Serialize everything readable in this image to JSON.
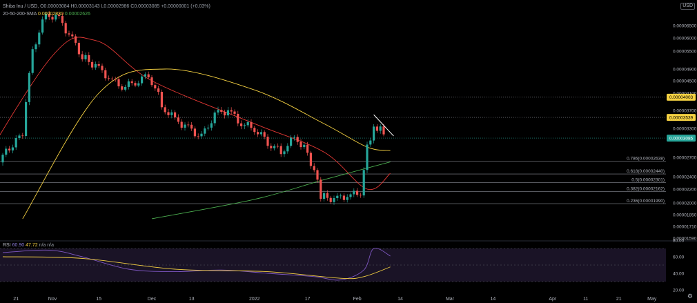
{
  "legend": {
    "title": "Shiba Inu / USD, ",
    "ohlc": "O0.00003084 H0.00003143 L0.00002986 C0.00003085 +0.00000001 (+0.03%)",
    "sma_label": "20-50-200-SMA",
    "sma_values": [
      "0.00002830",
      "0.00002626"
    ],
    "rsi_label": "RSI",
    "rsi_values": [
      "60.90",
      "47.72",
      "n/a",
      "n/a"
    ]
  },
  "currency_badge": "USD",
  "colors": {
    "background": "#000000",
    "up": "#26a69a",
    "down": "#ef5350",
    "sma20": "#e53935",
    "sma50": "#f5d142",
    "sma200": "#4caf50",
    "rsi": "#7e57c2",
    "rsi_ma": "#f5d142",
    "current_price": "#26a69a",
    "highlight_level": "#f5d142",
    "trendline": "#ffffff"
  },
  "chart_data": {
    "type": "line",
    "subtype": "candlestick",
    "x_ticks": [
      "21",
      "Nov",
      "15",
      "Dec",
      "13",
      "2022",
      "17",
      "Feb",
      "14",
      "Mar",
      "14",
      "Apr",
      "11",
      "21",
      "May"
    ],
    "y_ticks": [
      "0.00006500",
      "0.00006000",
      "0.00005500",
      "0.00004900",
      "0.00004500",
      "0.00004100",
      "0.00003700",
      "0.00003300",
      "0.00002700",
      "0.00002400",
      "0.00002200",
      "0.00002000",
      "0.00001850",
      "0.00001710",
      "0.00001590"
    ],
    "ylim": [
      1.59e-05,
      7e-05
    ],
    "grid": false,
    "series": [
      {
        "kind": "candles",
        "points": [
          {
            "date": "2021-10-17",
            "value": 2.7e-05
          },
          {
            "date": "2021-10-20",
            "value": 2.85e-05
          },
          {
            "date": "2021-10-24",
            "value": 3.2e-05
          },
          {
            "date": "2021-10-27",
            "value": 5.5e-05
          },
          {
            "date": "2021-10-31",
            "value": 7e-05
          },
          {
            "date": "2021-11-04",
            "value": 6.8e-05
          },
          {
            "date": "2021-11-08",
            "value": 5.9e-05
          },
          {
            "date": "2021-11-11",
            "value": 5.3e-05
          },
          {
            "date": "2021-11-15",
            "value": 5e-05
          },
          {
            "date": "2021-11-19",
            "value": 4.6e-05
          },
          {
            "date": "2021-11-23",
            "value": 4.3e-05
          },
          {
            "date": "2021-11-27",
            "value": 4.45e-05
          },
          {
            "date": "2021-12-01",
            "value": 4.7e-05
          },
          {
            "date": "2021-12-05",
            "value": 3.8e-05
          },
          {
            "date": "2021-12-09",
            "value": 3.5e-05
          },
          {
            "date": "2021-12-13",
            "value": 3.3e-05
          },
          {
            "date": "2021-12-17",
            "value": 3.1e-05
          },
          {
            "date": "2021-12-21",
            "value": 3.6e-05
          },
          {
            "date": "2021-12-25",
            "value": 3.7e-05
          },
          {
            "date": "2021-12-29",
            "value": 3.4e-05
          },
          {
            "date": "2022-01-02",
            "value": 3.3e-05
          },
          {
            "date": "2022-01-06",
            "value": 3e-05
          },
          {
            "date": "2022-01-10",
            "value": 2.8e-05
          },
          {
            "date": "2022-01-14",
            "value": 3.1e-05
          },
          {
            "date": "2022-01-17",
            "value": 2.9e-05
          },
          {
            "date": "2022-01-20",
            "value": 2.5e-05
          },
          {
            "date": "2022-01-22",
            "value": 2.1e-05
          },
          {
            "date": "2022-01-26",
            "value": 2.05e-05
          },
          {
            "date": "2022-01-30",
            "value": 2.1e-05
          },
          {
            "date": "2022-02-03",
            "value": 2.15e-05
          },
          {
            "date": "2022-02-05",
            "value": 2.9e-05
          },
          {
            "date": "2022-02-07",
            "value": 3.3e-05
          },
          {
            "date": "2022-02-09",
            "value": 3.35e-05
          },
          {
            "date": "2022-02-11",
            "value": 3.085e-05
          }
        ]
      },
      {
        "kind": "sma20",
        "points": [
          {
            "date": "2021-10-01",
            "value": 1.8e-05
          },
          {
            "date": "2021-10-31",
            "value": 5.2e-05
          },
          {
            "date": "2021-11-14",
            "value": 5.9e-05
          },
          {
            "date": "2021-12-01",
            "value": 4.5e-05
          },
          {
            "date": "2022-01-01",
            "value": 3.4e-05
          },
          {
            "date": "2022-01-22",
            "value": 2.8e-05
          },
          {
            "date": "2022-02-04",
            "value": 2.2e-05
          },
          {
            "date": "2022-02-11",
            "value": 2.45e-05
          }
        ]
      },
      {
        "kind": "sma50",
        "points": [
          {
            "date": "2021-10-23",
            "value": 1.8e-05
          },
          {
            "date": "2021-11-15",
            "value": 4.1e-05
          },
          {
            "date": "2021-12-05",
            "value": 4.9e-05
          },
          {
            "date": "2022-01-01",
            "value": 4.2e-05
          },
          {
            "date": "2022-01-22",
            "value": 3.4e-05
          },
          {
            "date": "2022-02-04",
            "value": 2.9e-05
          },
          {
            "date": "2022-02-11",
            "value": 2.83e-05
          }
        ]
      },
      {
        "kind": "sma200",
        "points": [
          {
            "date": "2021-12-01",
            "value": 1.8e-05
          },
          {
            "date": "2022-01-01",
            "value": 2.05e-05
          },
          {
            "date": "2022-01-22",
            "value": 2.35e-05
          },
          {
            "date": "2022-02-11",
            "value": 2.626e-05
          }
        ]
      }
    ],
    "fib_levels": [
      {
        "label": "0.786(0.00002638)",
        "value": 2.638e-05
      },
      {
        "label": "0.618(0.00002440)",
        "value": 2.44e-05
      },
      {
        "label": "0.5(0.00002301)",
        "value": 2.301e-05
      },
      {
        "label": "0.382(0.00002162)",
        "value": 2.162e-05
      },
      {
        "label": "0.236(0.00001990)",
        "value": 1.99e-05
      }
    ],
    "price_labels": [
      {
        "label": "0.00004003",
        "value": 4.003e-05,
        "style": "highlight"
      },
      {
        "label": "0.00003539",
        "value": 3.539e-05,
        "style": "highlight"
      },
      {
        "label": "0.00003085",
        "value": 3.085e-05,
        "style": "current"
      }
    ],
    "rsi": {
      "y_ticks": [
        "80.00",
        "60.00",
        "40.00",
        "20.00"
      ],
      "ylim": [
        20,
        80
      ],
      "band": [
        30,
        70
      ],
      "points": [
        {
          "date": "2021-10-17",
          "value": 65
        },
        {
          "date": "2021-10-31",
          "value": 68
        },
        {
          "date": "2021-11-10",
          "value": 60
        },
        {
          "date": "2021-11-24",
          "value": 45
        },
        {
          "date": "2021-12-08",
          "value": 42
        },
        {
          "date": "2021-12-22",
          "value": 44
        },
        {
          "date": "2022-01-05",
          "value": 40
        },
        {
          "date": "2022-01-19",
          "value": 36
        },
        {
          "date": "2022-01-27",
          "value": 32
        },
        {
          "date": "2022-02-03",
          "value": 44
        },
        {
          "date": "2022-02-06",
          "value": 70
        },
        {
          "date": "2022-02-11",
          "value": 60.9
        }
      ],
      "ma_points": [
        {
          "date": "2021-10-17",
          "value": 60
        },
        {
          "date": "2021-11-10",
          "value": 58
        },
        {
          "date": "2021-12-08",
          "value": 45
        },
        {
          "date": "2022-01-05",
          "value": 42
        },
        {
          "date": "2022-01-27",
          "value": 34
        },
        {
          "date": "2022-02-03",
          "value": 36
        },
        {
          "date": "2022-02-11",
          "value": 47.72
        }
      ]
    }
  }
}
